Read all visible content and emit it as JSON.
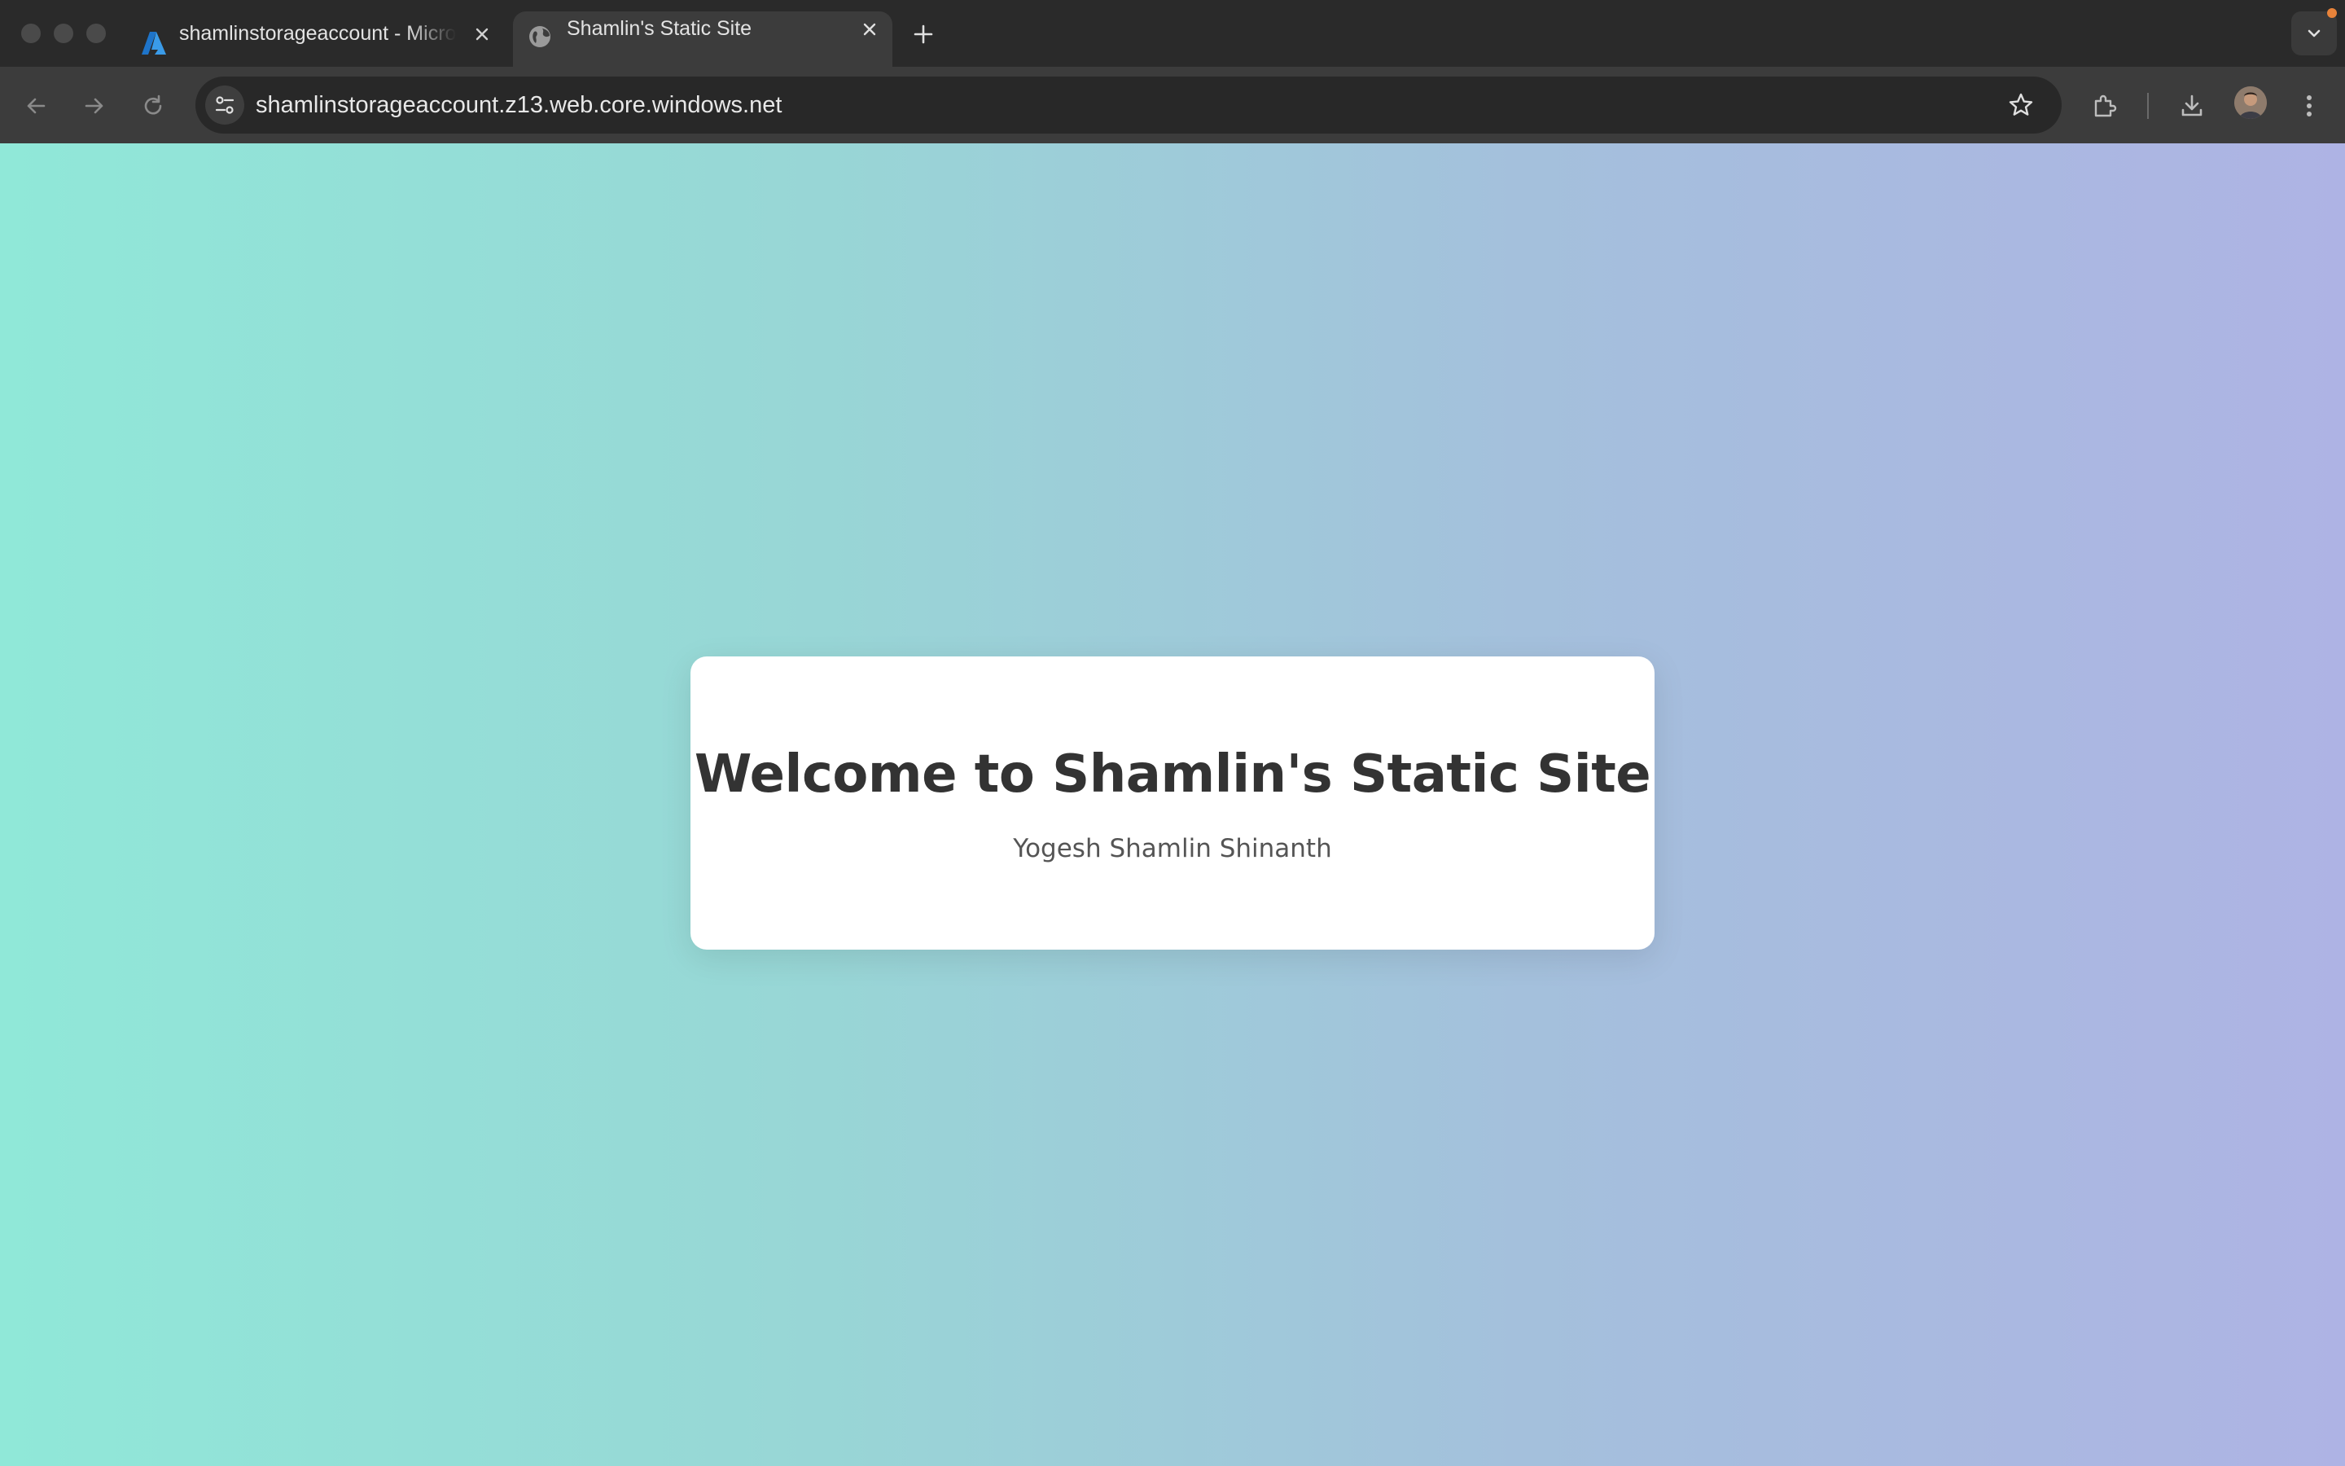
{
  "browser": {
    "tabs": [
      {
        "title": "shamlinstorageaccount - Microsoft Azure",
        "favicon": "azure-logo-icon",
        "active": false
      },
      {
        "title": "Shamlin's Static Site",
        "favicon": "globe-icon",
        "active": true
      }
    ],
    "address_bar": {
      "url": "shamlinstorageaccount.z13.web.core.windows.net"
    },
    "toolbar_icons": [
      "back-icon",
      "forward-icon",
      "reload-icon",
      "site-info-icon",
      "bookmark-star-icon",
      "extensions-icon",
      "download-icon",
      "profile-avatar",
      "menu-icon"
    ]
  },
  "page": {
    "heading": "Welcome to Shamlin's Static Site",
    "subtitle": "Yogesh Shamlin Shinanth"
  },
  "colors": {
    "gradient_start": "#90e8d8",
    "gradient_end": "#aeb3e4",
    "card_background": "#ffffff",
    "heading_color": "#333333"
  }
}
